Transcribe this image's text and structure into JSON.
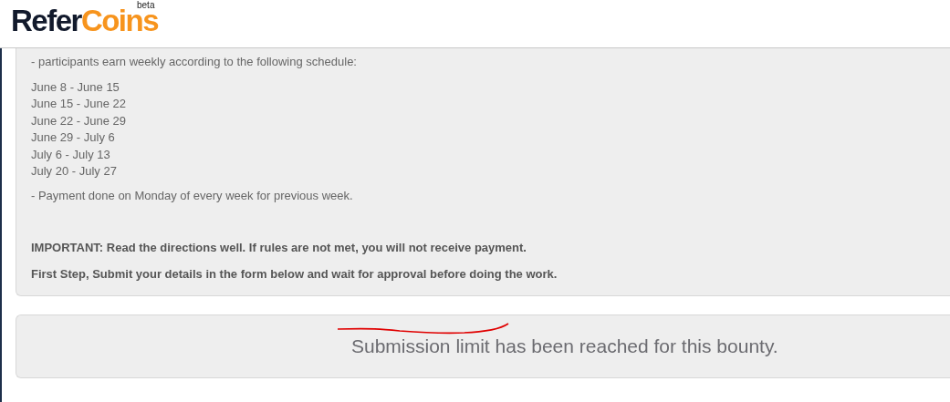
{
  "header": {
    "logo": {
      "first": "Refer",
      "second": "Coins",
      "badge": "beta"
    }
  },
  "details": {
    "intro": "- participants earn weekly according to the following schedule:",
    "schedule": [
      "June 8 - June 15",
      "June 15 - June 22",
      "June 22 - June 29",
      "June 29 - July 6",
      "July 6 - July 13",
      "July 20 - July 27"
    ],
    "payment_note": "- Payment done on Monday of every week for previous week.",
    "important": "IMPORTANT: Read the directions well. If rules are not met, you will not receive payment.",
    "first_step": "First Step, Submit your details in the form below and wait for approval before doing the work."
  },
  "status": {
    "message": "Submission limit has been reached for this bounty."
  }
}
